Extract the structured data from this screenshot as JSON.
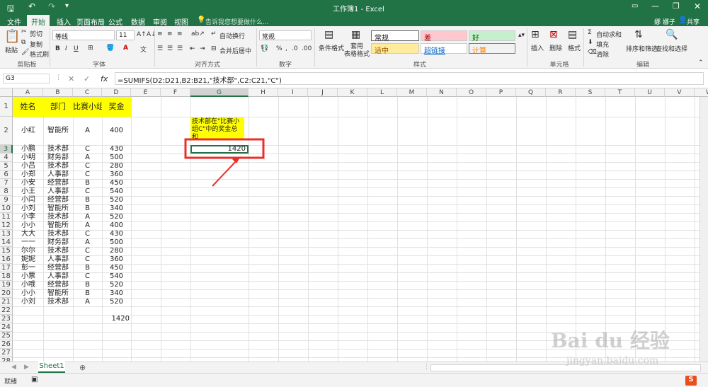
{
  "title": "工作簿1 - Excel",
  "user": "娜 娜子",
  "share": "共享",
  "tabs": [
    "文件",
    "开始",
    "插入",
    "页面布局",
    "公式",
    "数据",
    "审阅",
    "视图"
  ],
  "tell_me": "告诉我您想要做什么...",
  "clipboard": {
    "paste": "粘贴",
    "cut": "剪切",
    "copy": "复制",
    "format_painter": "格式刷",
    "group": "剪贴板"
  },
  "font": {
    "name": "等线",
    "size": "11",
    "group": "字体"
  },
  "align": {
    "wrap": "自动换行",
    "merge": "合并后居中",
    "group": "对齐方式"
  },
  "number": {
    "format": "常规",
    "group": "数字"
  },
  "styles": {
    "cond": "条件格式",
    "table": "套用\n表格格式",
    "normal": "常规",
    "bad": "差",
    "good": "好",
    "neutral": "适中",
    "hyperlink": "超链接",
    "calc": "计算",
    "group": "样式"
  },
  "cells": {
    "insert": "插入",
    "delete": "删除",
    "format": "格式",
    "group": "单元格"
  },
  "editing": {
    "autosum": "自动求和",
    "fill": "填充",
    "clear": "清除",
    "sort": "排序和筛选",
    "find": "查找和选择",
    "group": "编辑"
  },
  "namebox": "G3",
  "formula": "=SUMIFS(D2:D21,B2:B21,\"技术部\",C2:C21,\"C\")",
  "columns": [
    "A",
    "B",
    "C",
    "D",
    "E",
    "F",
    "G",
    "H",
    "I",
    "J",
    "K",
    "L",
    "M",
    "N",
    "O",
    "P",
    "Q",
    "R",
    "S",
    "T",
    "U",
    "V",
    "W"
  ],
  "headers": [
    "姓名",
    "部门",
    "比赛小组",
    "奖金"
  ],
  "rows": [
    [
      "小红",
      "智能所",
      "A",
      "400"
    ],
    [
      "小鹏",
      "技术部",
      "C",
      "430"
    ],
    [
      "小明",
      "财务部",
      "A",
      "500"
    ],
    [
      "小吕",
      "技术部",
      "C",
      "280"
    ],
    [
      "小郑",
      "人事部",
      "C",
      "360"
    ],
    [
      "小安",
      "经营部",
      "B",
      "450"
    ],
    [
      "小王",
      "人事部",
      "C",
      "540"
    ],
    [
      "小闫",
      "经营部",
      "B",
      "520"
    ],
    [
      "小刘",
      "智能所",
      "B",
      "340"
    ],
    [
      "小李",
      "技术部",
      "A",
      "520"
    ],
    [
      "小小",
      "智能所",
      "A",
      "400"
    ],
    [
      "大大",
      "技术部",
      "C",
      "430"
    ],
    [
      "一一",
      "财务部",
      "A",
      "500"
    ],
    [
      "尔尔",
      "技术部",
      "C",
      "280"
    ],
    [
      "妮妮",
      "人事部",
      "C",
      "360"
    ],
    [
      "彭一",
      "经营部",
      "B",
      "450"
    ],
    [
      "小票",
      "人事部",
      "C",
      "540"
    ],
    [
      "小哦",
      "经营部",
      "B",
      "520"
    ],
    [
      "小小",
      "智能所",
      "B",
      "340"
    ],
    [
      "小刘",
      "技术部",
      "A",
      "520"
    ]
  ],
  "d23": "1420",
  "g2": "技术部在\"比赛小组C\"中的奖金总和",
  "g3": "1420",
  "sheet": "Sheet1",
  "status": "就绪",
  "watermark": "Bai du 经验",
  "watermark_url": "jingyan.baidu.com"
}
